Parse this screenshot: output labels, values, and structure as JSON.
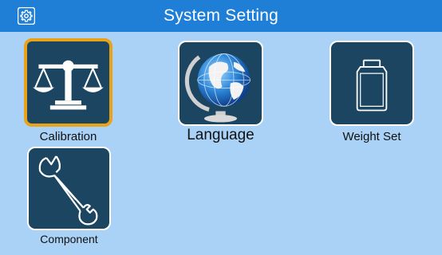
{
  "header": {
    "title": "System Setting",
    "settings_icon": "gear-icon"
  },
  "menu": {
    "items": [
      {
        "label": "Calibration",
        "icon": "balance-scale-icon",
        "selected": true
      },
      {
        "label": "Language",
        "icon": "globe-icon",
        "selected": false
      },
      {
        "label": "Weight Set",
        "icon": "weight-container-icon",
        "selected": false
      },
      {
        "label": "Component",
        "icon": "wrench-icon",
        "selected": false
      }
    ]
  },
  "colors": {
    "background": "#a9d2f6",
    "header": "#1f7fd6",
    "tile": "#1b4560",
    "selection": "#e8a31a"
  }
}
